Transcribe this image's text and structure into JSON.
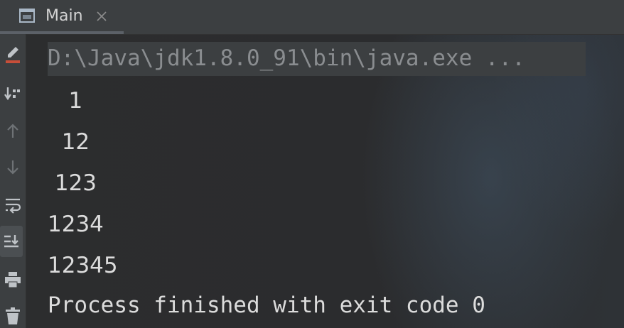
{
  "tab": {
    "label": "Main",
    "icon": "console-window-icon",
    "close_icon": "close-icon"
  },
  "toolbar": {
    "items": [
      {
        "icon": "clear-all-icon"
      },
      {
        "icon": "sort-down-icon"
      },
      {
        "icon": "up-arrow-icon"
      },
      {
        "icon": "down-arrow-icon"
      },
      {
        "icon": "soft-wrap-icon"
      },
      {
        "icon": "scroll-to-end-icon"
      },
      {
        "icon": "print-icon"
      },
      {
        "icon": "trash-icon"
      }
    ]
  },
  "console": {
    "command": "D:\\Java\\jdk1.8.0_91\\bin\\java.exe ...",
    "output": [
      "   1",
      "  12",
      " 123",
      "1234",
      "12345"
    ],
    "exit_message": "Process finished with exit code 0"
  },
  "colors": {
    "background": "#2b2b2b",
    "panel": "#3c3f41",
    "text": "#dcdcdc",
    "command_text": "#8a8d90",
    "accent_red": "#c74e39"
  }
}
